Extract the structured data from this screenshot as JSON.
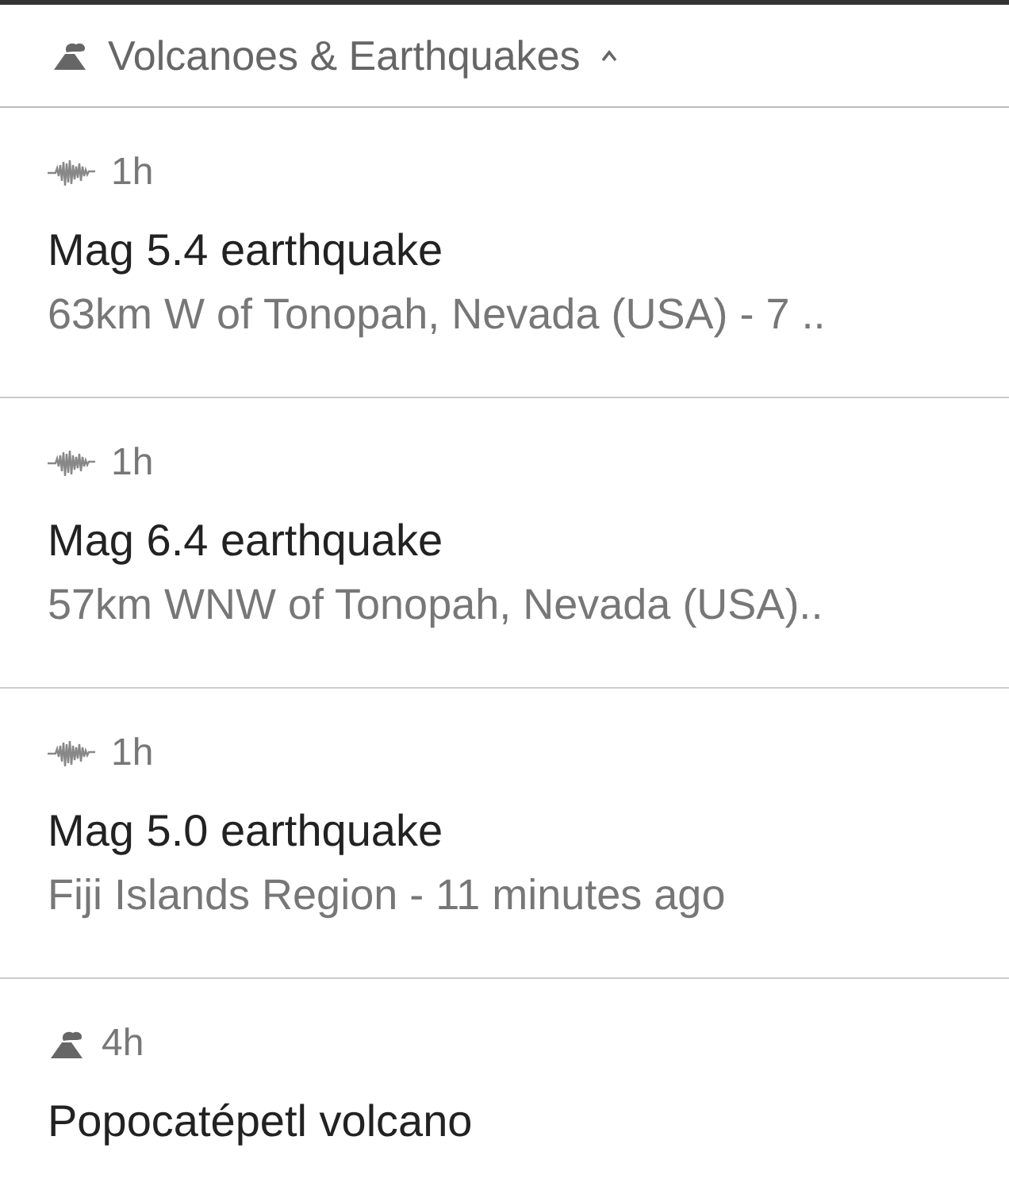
{
  "header": {
    "title": "Volcanoes & Earthquakes",
    "expanded": true
  },
  "items": [
    {
      "kind": "earthquake",
      "time": "1h",
      "title": "Mag 5.4 earthquake",
      "subtitle": "63km W of Tonopah, Nevada (USA) - 7 .."
    },
    {
      "kind": "earthquake",
      "time": "1h",
      "title": "Mag 6.4 earthquake",
      "subtitle": "57km WNW of Tonopah, Nevada (USA).."
    },
    {
      "kind": "earthquake",
      "time": "1h",
      "title": "Mag 5.0 earthquake",
      "subtitle": "Fiji Islands Region - 11 minutes ago"
    },
    {
      "kind": "volcano",
      "time": "4h",
      "title": "Popocatépetl volcano"
    }
  ]
}
